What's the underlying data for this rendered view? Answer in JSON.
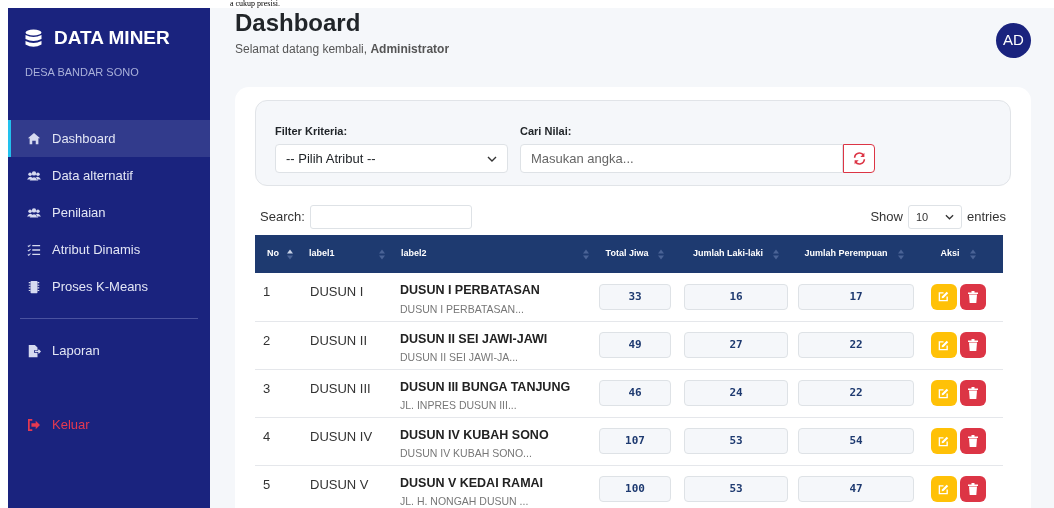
{
  "caption_fragment": "a cukup presisi.",
  "sidebar": {
    "brand": "DATA MINER",
    "subtitle": "DESA BANDAR SONO",
    "menu": [
      {
        "label": "Dashboard",
        "selected": true
      },
      {
        "label": "Data alternatif",
        "selected": false
      },
      {
        "label": "Penilaian",
        "selected": false
      },
      {
        "label": "Atribut Dinamis",
        "selected": false
      },
      {
        "label": "Proses K-Means",
        "selected": false
      }
    ],
    "reports": [
      {
        "label": "Laporan",
        "selected": false
      }
    ],
    "logout": {
      "label": "Keluar"
    }
  },
  "header": {
    "title": "Dashboard",
    "welcome": "Selamat datang kembali, **Administrator**",
    "avatar": "AD"
  },
  "filter": {
    "criteria_label": "Filter Kriteria:",
    "criteria_value": "-- Pilih Atribut --",
    "search_label": "Cari Nilai:",
    "search_placeholder": "Masukan angka..."
  },
  "table": {
    "search_label": "Search:",
    "show_label": "Show",
    "page_size": "10",
    "entries_label": "entries",
    "columns": [
      {
        "label": "No",
        "sorted": true
      },
      {
        "label": "label1",
        "sorted": false
      },
      {
        "label": "label2",
        "sorted": false
      },
      {
        "label": "Total Jiwa",
        "sorted": false
      },
      {
        "label": "Jumlah Laki-laki",
        "sorted": false
      },
      {
        "label": "Jumlah Perempuan",
        "sorted": false
      },
      {
        "label": "Aksi",
        "sorted": false
      }
    ],
    "rows": [
      {
        "no": "1",
        "label1": "DUSUN I",
        "name": "DUSUN I PERBATASAN",
        "detail": "DUSUN I PERBATASAN...",
        "total": "33",
        "male": "16",
        "female": "17"
      },
      {
        "no": "2",
        "label1": "DUSUN II",
        "name": "DUSUN II SEI JAWI-JAWI",
        "detail": "DUSUN II SEI JAWI-JA...",
        "total": "49",
        "male": "27",
        "female": "22"
      },
      {
        "no": "3",
        "label1": "DUSUN III",
        "name": "DUSUN III BUNGA TANJUNG",
        "detail": "JL. INPRES DUSUN III...",
        "total": "46",
        "male": "24",
        "female": "22"
      },
      {
        "no": "4",
        "label1": "DUSUN IV",
        "name": "DUSUN IV KUBAH SONO",
        "detail": "DUSUN IV KUBAH SONO...",
        "total": "107",
        "male": "53",
        "female": "54"
      },
      {
        "no": "5",
        "label1": "DUSUN V",
        "name": "DUSUN V KEDAI RAMAI",
        "detail": "JL. H. NONGAH DUSUN ...",
        "total": "100",
        "male": "53",
        "female": "47"
      }
    ]
  }
}
